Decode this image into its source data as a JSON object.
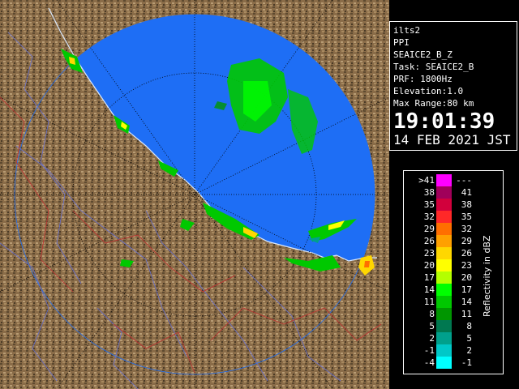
{
  "info": {
    "station": "ilts2",
    "product": "PPI",
    "product_name": "SEAICE2_B_Z",
    "task": "Task: SEAICE2_B",
    "prf": "PRF: 1800Hz",
    "elevation": "Elevation:1.0",
    "max_range": "Max Range:80 km",
    "time": "19:01:39",
    "date": "14 FEB 2021 JST"
  },
  "legend": {
    "unit": "Reflectivity in dBZ",
    "rows": [
      {
        "lo": ">41",
        "hi": "---",
        "color": "#ff00ff"
      },
      {
        "lo": "38",
        "hi": "41",
        "color": "#a0005a"
      },
      {
        "lo": "35",
        "hi": "38",
        "color": "#d2003c"
      },
      {
        "lo": "32",
        "hi": "35",
        "color": "#ff2828"
      },
      {
        "lo": "29",
        "hi": "32",
        "color": "#ff6e00"
      },
      {
        "lo": "26",
        "hi": "29",
        "color": "#ffa000"
      },
      {
        "lo": "23",
        "hi": "26",
        "color": "#ffd700"
      },
      {
        "lo": "20",
        "hi": "23",
        "color": "#ffff00"
      },
      {
        "lo": "17",
        "hi": "20",
        "color": "#b4ff00"
      },
      {
        "lo": "14",
        "hi": "17",
        "color": "#00ff00"
      },
      {
        "lo": "11",
        "hi": "14",
        "color": "#00c800"
      },
      {
        "lo": "8",
        "hi": "11",
        "color": "#009600"
      },
      {
        "lo": "5",
        "hi": "8",
        "color": "#007850"
      },
      {
        "lo": "2",
        "hi": "5",
        "color": "#00a08c"
      },
      {
        "lo": "-1",
        "hi": "2",
        "color": "#00c8c8"
      },
      {
        "lo": "-4",
        "hi": "-1",
        "color": "#00ffff"
      }
    ]
  },
  "colors": {
    "sea": "#1e6ef5",
    "land": "#7a6040",
    "range_ring": "#000000"
  }
}
